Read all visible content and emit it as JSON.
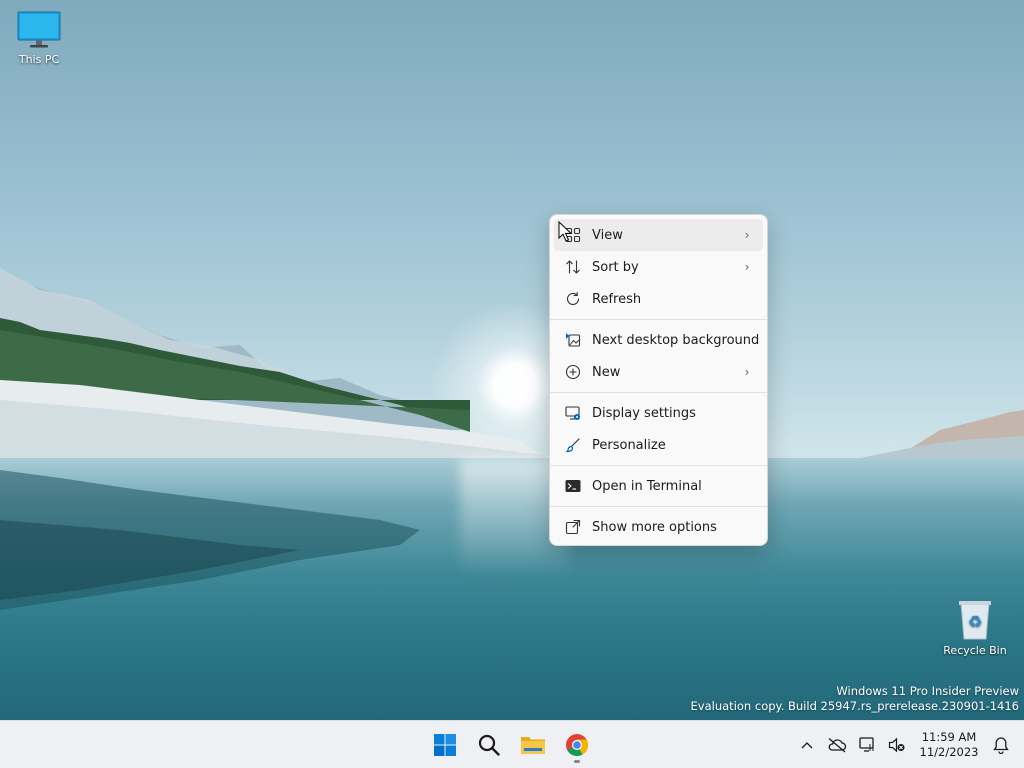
{
  "desktop": {
    "icons": [
      {
        "label": "This PC",
        "icon": "this-pc-icon"
      },
      {
        "label": "Recycle Bin",
        "icon": "recycle-bin-icon"
      }
    ],
    "watermark": {
      "line1": "Windows 11 Pro Insider Preview",
      "line2": "Evaluation copy. Build 25947.rs_prerelease.230901-1416"
    }
  },
  "context_menu": {
    "items": [
      {
        "label": "View",
        "icon": "view-grid-icon",
        "submenu": true
      },
      {
        "label": "Sort by",
        "icon": "sort-icon",
        "submenu": true
      },
      {
        "label": "Refresh",
        "icon": "refresh-icon",
        "submenu": false
      },
      {
        "label": "Next desktop background",
        "icon": "next-background-icon",
        "submenu": false
      },
      {
        "label": "New",
        "icon": "new-plus-icon",
        "submenu": true
      },
      {
        "label": "Display settings",
        "icon": "display-settings-icon",
        "submenu": false
      },
      {
        "label": "Personalize",
        "icon": "personalize-brush-icon",
        "submenu": false
      },
      {
        "label": "Open in Terminal",
        "icon": "terminal-icon",
        "submenu": false
      },
      {
        "label": "Show more options",
        "icon": "show-more-options-icon",
        "submenu": false
      }
    ],
    "chevron": "›"
  },
  "taskbar": {
    "apps": [
      {
        "name": "Start",
        "icon": "windows-start-icon"
      },
      {
        "name": "Search",
        "icon": "search-icon"
      },
      {
        "name": "File Explorer",
        "icon": "file-explorer-icon"
      },
      {
        "name": "Google Chrome",
        "icon": "chrome-icon"
      }
    ],
    "tray": {
      "chevron": "^",
      "clock_time": "11:59 AM",
      "clock_date": "11/2/2023"
    }
  },
  "colors": {
    "accent": "#0067c0",
    "menu_bg": "#f9f9f9",
    "taskbar_bg": "#eef0f3"
  }
}
